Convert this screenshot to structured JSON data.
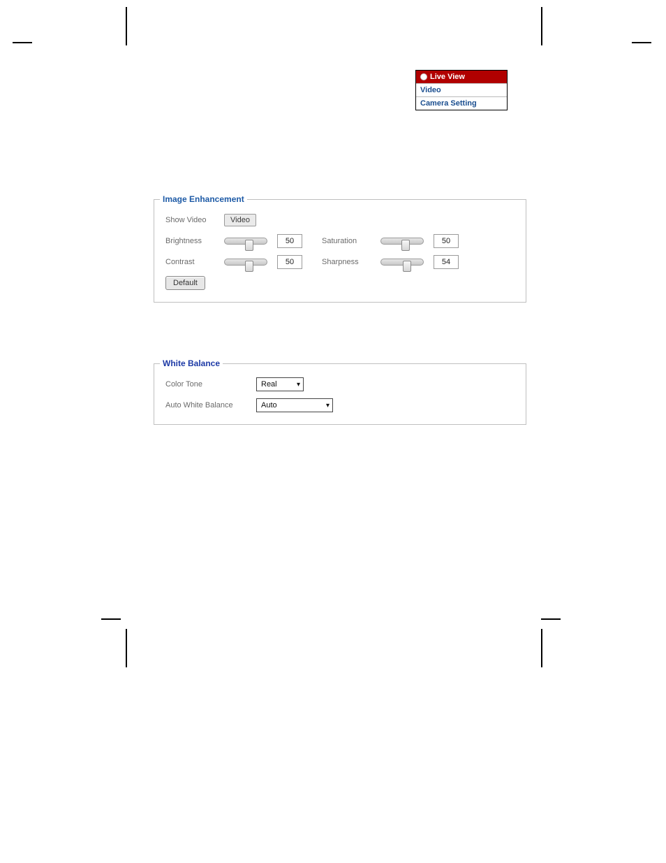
{
  "nav": {
    "active": "Live View",
    "items": [
      "Video",
      "Camera Setting"
    ]
  },
  "imageEnhancement": {
    "legend": "Image Enhancement",
    "showVideoLabel": "Show Video",
    "videoButton": "Video",
    "brightness": {
      "label": "Brightness",
      "value": "50"
    },
    "contrast": {
      "label": "Contrast",
      "value": "50"
    },
    "saturation": {
      "label": "Saturation",
      "value": "50"
    },
    "sharpness": {
      "label": "Sharpness",
      "value": "54"
    },
    "defaultButton": "Default"
  },
  "whiteBalance": {
    "legend": "White Balance",
    "colorTone": {
      "label": "Color Tone",
      "value": "Real"
    },
    "autoWhiteBalance": {
      "label": "Auto White Balance",
      "value": "Auto"
    }
  }
}
